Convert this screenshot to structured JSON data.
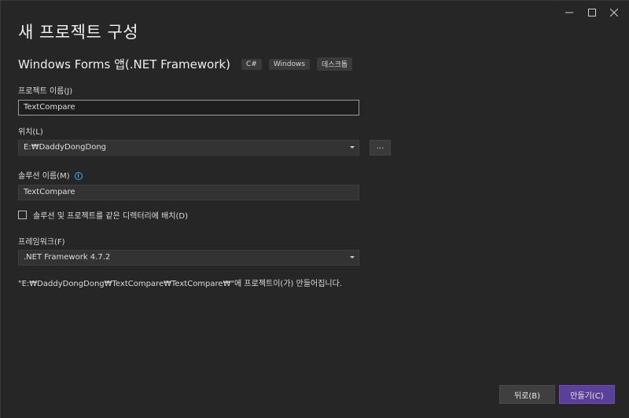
{
  "window": {
    "controls": {
      "minimize": "minimize",
      "maximize": "maximize",
      "close": "close"
    }
  },
  "header": {
    "title": "새 프로젝트 구성",
    "template_name": "Windows Forms 앱(.NET Framework)",
    "tags": [
      "C#",
      "Windows",
      "데스크톱"
    ]
  },
  "form": {
    "project_name": {
      "label": "프로젝트 이름(J)",
      "value": "TextCompare"
    },
    "location": {
      "label": "위치(L)",
      "value": "E:₩DaddyDongDong",
      "browse_label": "..."
    },
    "solution_name": {
      "label": "솔루션 이름(M)",
      "value": "TextCompare",
      "info_icon": "i"
    },
    "same_directory": {
      "label": "솔루션 및 프로젝트를 같은 디렉터리에 배치(D)",
      "checked": false
    },
    "framework": {
      "label": "프레임워크(F)",
      "value": ".NET Framework 4.7.2"
    },
    "path_note": "\"E:₩DaddyDongDong₩TextCompare₩TextCompare₩\"에 프로젝트이(가) 만들어집니다."
  },
  "footer": {
    "back_label": "뒤로(B)",
    "create_label": "만들기(C)"
  },
  "colors": {
    "background": "#262626",
    "accent": "#5b3f98",
    "info": "#4aa3f0"
  }
}
